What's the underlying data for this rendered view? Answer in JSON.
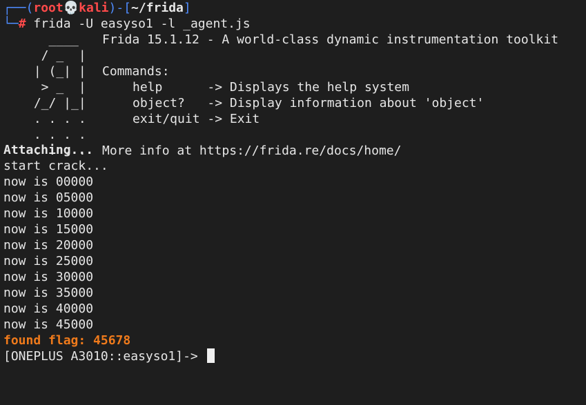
{
  "prompt": {
    "bracket_open": "┌──(",
    "user": "root",
    "host": "kali",
    "mid": ")-[",
    "path": "~/frida",
    "bracket_close": "]",
    "second_prefix": "└─",
    "hash": "#",
    "command": " frida -U easyso1 -l _agent.js"
  },
  "banner": {
    "logo": [
      "   ____",
      "  / _  |",
      " | (_| |",
      "  > _  |",
      " /_/ |_|",
      " . . . .",
      " . . . .",
      " . . . ."
    ],
    "title": "Frida 15.1.12 - A world-class dynamic instrumentation toolkit",
    "commands_label": "Commands:",
    "commands": [
      "help      -> Displays the help system",
      "object?   -> Display information about 'object'",
      "exit/quit -> Exit"
    ],
    "more_info": "More info at https://frida.re/docs/home/"
  },
  "output": {
    "attaching": "Attaching...",
    "start": "start crack...",
    "progress": [
      "now is 00000",
      "now is 05000",
      "now is 10000",
      "now is 15000",
      "now is 20000",
      "now is 25000",
      "now is 30000",
      "now is 35000",
      "now is 40000",
      "now is 45000"
    ],
    "flag": "found flag: 45678",
    "repl_prompt": "[ONEPLUS A3010::easyso1]-> "
  },
  "colors": {
    "background": "#1e1e1e",
    "prompt_blue": "#4f8cff",
    "root_red": "#ff4a4a",
    "flag_orange": "#ef7a1b"
  },
  "icons": {
    "skull": "skull-icon"
  }
}
